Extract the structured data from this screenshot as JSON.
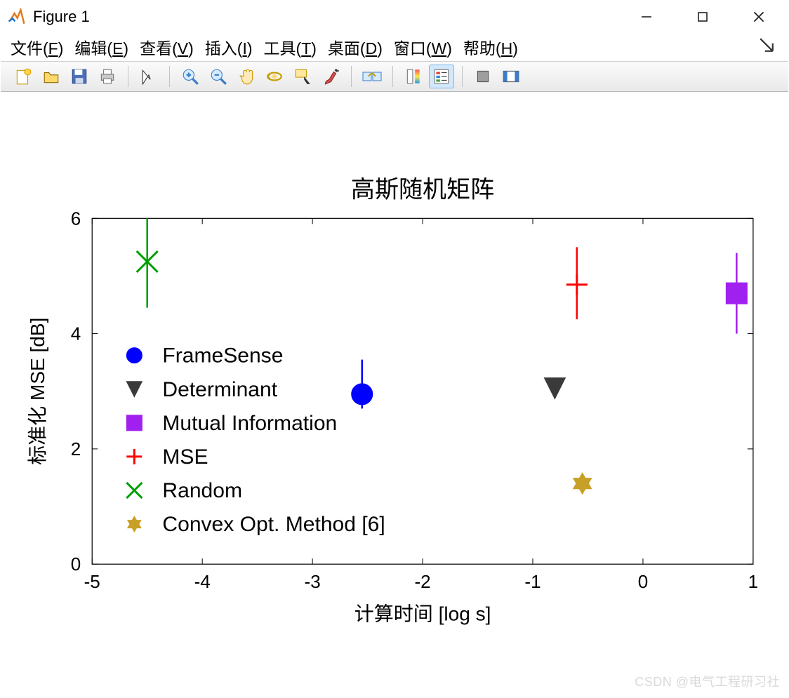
{
  "window": {
    "title": "Figure 1",
    "minimize": "Minimize",
    "maximize": "Maximize",
    "close": "Close"
  },
  "menubar": {
    "items": [
      {
        "label": "文件",
        "hotkey": "F"
      },
      {
        "label": "编辑",
        "hotkey": "E"
      },
      {
        "label": "查看",
        "hotkey": "V"
      },
      {
        "label": "插入",
        "hotkey": "I"
      },
      {
        "label": "工具",
        "hotkey": "T"
      },
      {
        "label": "桌面",
        "hotkey": "D"
      },
      {
        "label": "窗口",
        "hotkey": "W"
      },
      {
        "label": "帮助",
        "hotkey": "H"
      }
    ],
    "dock_tooltip": "Dock Figure"
  },
  "toolbar": {
    "buttons": [
      {
        "name": "new-figure-icon"
      },
      {
        "name": "open-file-icon"
      },
      {
        "name": "save-icon"
      },
      {
        "name": "print-icon"
      }
    ],
    "buttons2": [
      {
        "name": "edit-plot-icon"
      }
    ],
    "buttons3": [
      {
        "name": "zoom-in-icon"
      },
      {
        "name": "zoom-out-icon"
      },
      {
        "name": "pan-icon"
      },
      {
        "name": "rotate-3d-icon"
      },
      {
        "name": "data-cursor-icon"
      },
      {
        "name": "brush-icon"
      }
    ],
    "buttons4": [
      {
        "name": "link-plots-icon"
      }
    ],
    "buttons5": [
      {
        "name": "insert-colorbar-icon"
      },
      {
        "name": "insert-legend-icon"
      }
    ],
    "buttons6": [
      {
        "name": "hide-plot-tools-icon"
      },
      {
        "name": "show-plot-tools-icon"
      }
    ]
  },
  "watermark": "CSDN @电气工程研习社",
  "chart_data": {
    "type": "scatter",
    "title": "高斯随机矩阵",
    "xlabel": "计算时间 [log s]",
    "ylabel": "标准化 MSE [dB]",
    "xlim": [
      -5,
      1
    ],
    "ylim": [
      0,
      6
    ],
    "xticks": [
      -5,
      -4,
      -3,
      -2,
      -1,
      0,
      1
    ],
    "yticks": [
      0,
      2,
      4,
      6
    ],
    "legend_position": "inside-left",
    "series": [
      {
        "name": "FrameSense",
        "marker": "circle-filled",
        "color": "#0000ff",
        "x": -2.55,
        "y": 2.95,
        "err_lo": 2.7,
        "err_hi": 3.55
      },
      {
        "name": "Determinant",
        "marker": "triangle-down-fill",
        "color": "#3a3a3a",
        "x": -0.8,
        "y": 3.05,
        "err_lo": 3.05,
        "err_hi": 3.05
      },
      {
        "name": "Mutual Information",
        "marker": "square-filled",
        "color": "#a020f0",
        "x": 0.85,
        "y": 4.7,
        "err_lo": 4.0,
        "err_hi": 5.4
      },
      {
        "name": "MSE",
        "marker": "plus",
        "color": "#ff0000",
        "x": -0.6,
        "y": 4.85,
        "err_lo": 4.25,
        "err_hi": 5.5
      },
      {
        "name": "Random",
        "marker": "x",
        "color": "#00a000",
        "x": -4.5,
        "y": 5.25,
        "err_lo": 4.45,
        "err_hi": 6.0
      },
      {
        "name": "Convex Opt. Method [6]",
        "marker": "hexagram-filled",
        "color": "#c8a028",
        "x": -0.55,
        "y": 1.4,
        "err_lo": 1.35,
        "err_hi": 1.5
      }
    ]
  }
}
